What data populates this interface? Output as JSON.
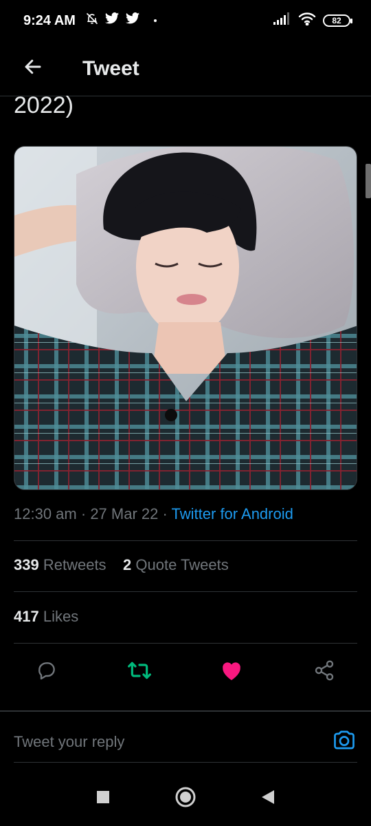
{
  "status_bar": {
    "time": "9:24 AM",
    "battery": "82"
  },
  "header": {
    "title": "Tweet"
  },
  "tweet": {
    "text_fragment": "2022)",
    "image_alt": "Photo of a young person with dark hair and closed eyes wearing a plaid shirt, holding a towel over their head",
    "time": "12:30 am",
    "date": "27 Mar 22",
    "separator": "·",
    "source": "Twitter for Android"
  },
  "stats": {
    "retweets_count": "339",
    "retweets_label": "Retweets",
    "quotes_count": "2",
    "quotes_label": "Quote Tweets",
    "likes_count": "417",
    "likes_label": "Likes"
  },
  "actions": {
    "reply_icon": "reply-icon",
    "retweet_icon": "retweet-icon",
    "like_icon": "heart-icon",
    "share_icon": "share-icon"
  },
  "reply_bar": {
    "placeholder": "Tweet your reply"
  },
  "colors": {
    "accent": "#1d9bf0",
    "retweet": "#00ba7c",
    "like": "#f91880",
    "background": "#000000"
  }
}
